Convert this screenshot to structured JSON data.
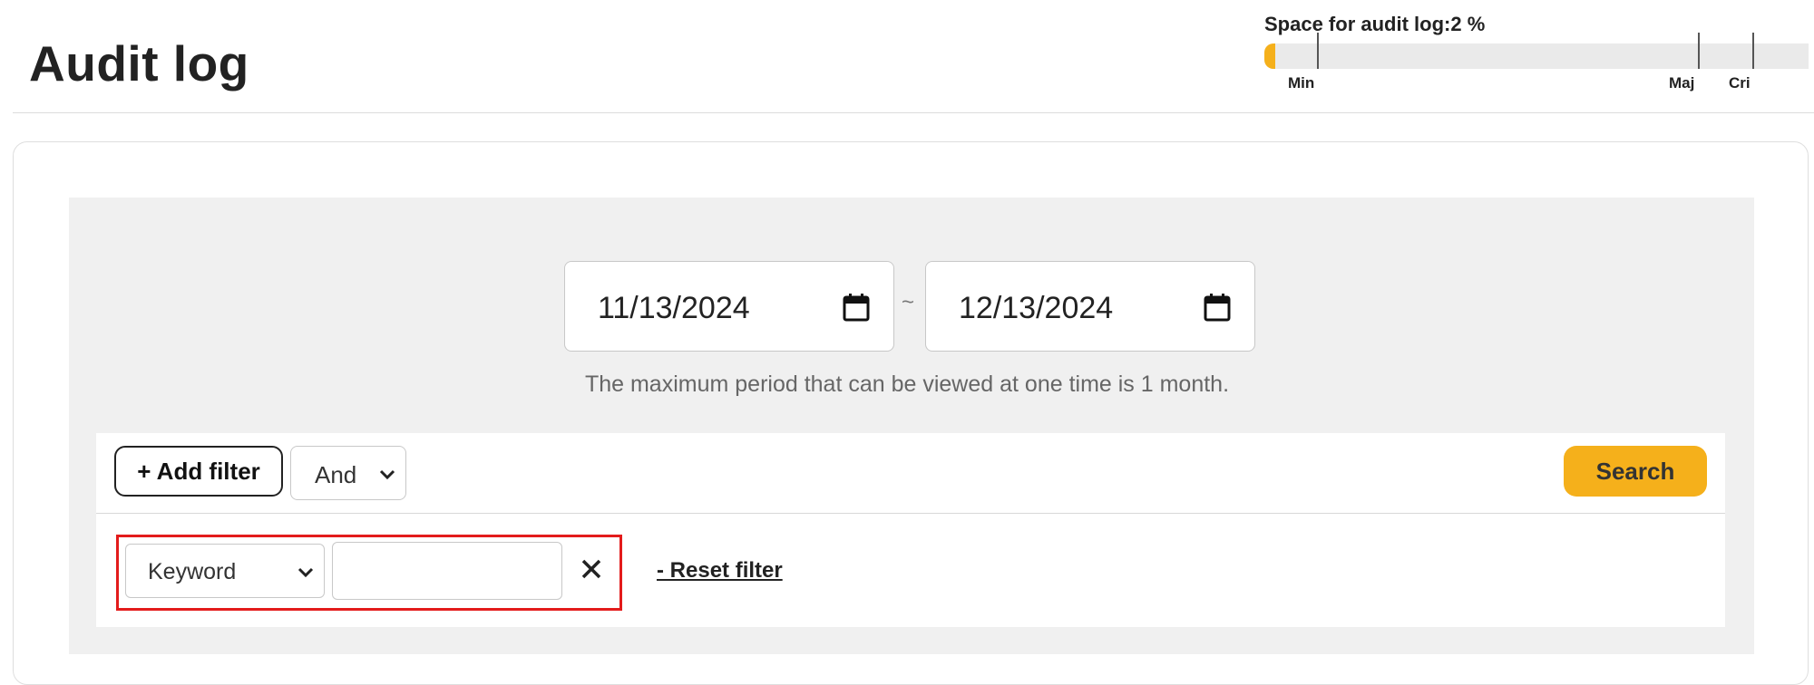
{
  "header": {
    "title": "Audit log"
  },
  "usage_meter": {
    "label": "Space for audit log:2 %",
    "percent": 2,
    "threshold_labels": [
      "Min",
      "Maj",
      "Cri"
    ],
    "fill_color": "#f5b01b"
  },
  "date_range": {
    "from": "11/13/2024",
    "to": "12/13/2024",
    "separator": "~",
    "note": "The maximum period that can be viewed at one time is 1 month.",
    "icon": "calendar-icon"
  },
  "filter_bar": {
    "add_filter_label": "+ Add filter",
    "logic_value": "And",
    "search_label": "Search",
    "search_color": "#f5b01b"
  },
  "filter_row": {
    "field_value": "Keyword",
    "keyword_value": "",
    "remove_icon": "close-icon",
    "reset_label": "- Reset filter",
    "highlight_color": "#e31b1b"
  }
}
